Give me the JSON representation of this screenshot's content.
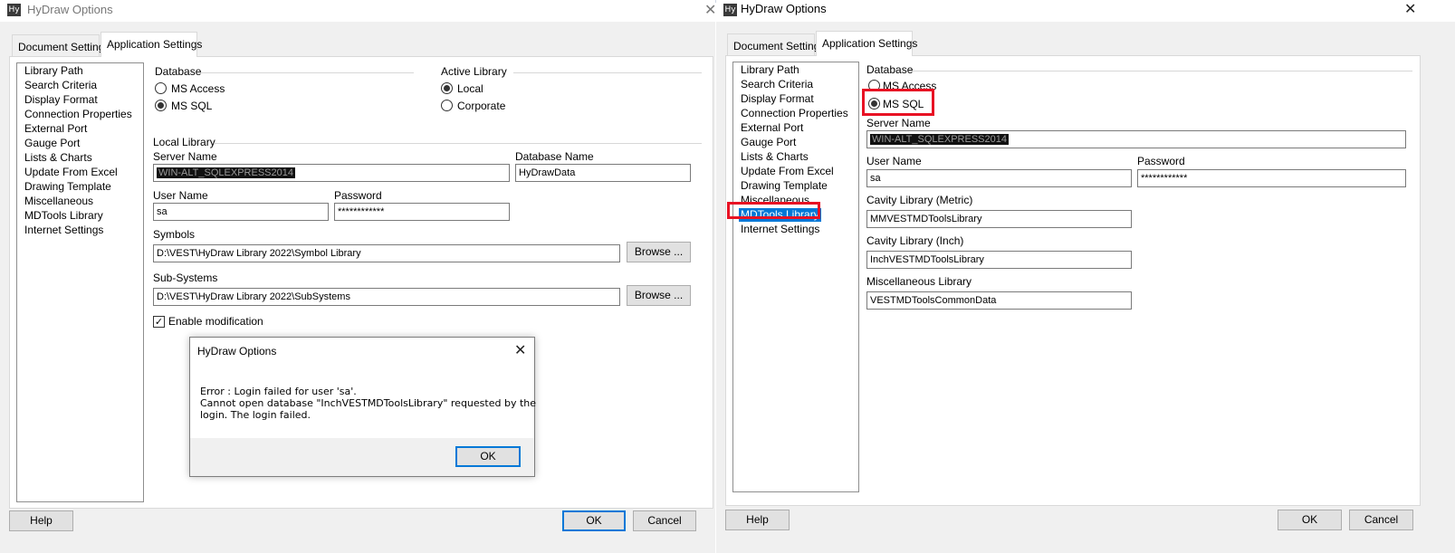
{
  "left_window": {
    "title": "HyDraw Options",
    "tabs": [
      "Document Settings",
      "Application Settings"
    ],
    "nav_items": [
      "Library Path",
      "Search Criteria",
      "Display Format",
      "Connection Properties",
      "External Port",
      "Gauge Port",
      "Lists & Charts",
      "Update From Excel",
      "Drawing Template",
      "Miscellaneous",
      "MDTools Library",
      "Internet Settings"
    ],
    "database_label": "Database",
    "db_options": [
      "MS Access",
      "MS SQL"
    ],
    "db_selected": "MS SQL",
    "active_library_label": "Active Library",
    "active_options": [
      "Local",
      "Corporate"
    ],
    "active_selected": "Local",
    "local_library_label": "Local Library",
    "server_name_label": "Server Name",
    "server_name_value": "WIN-ALT_SQLEXPRESS2014",
    "database_name_label": "Database Name",
    "database_name_value": "HyDrawData",
    "user_name_label": "User Name",
    "user_name_value": "sa",
    "password_label": "Password",
    "password_value": "************",
    "symbols_label": "Symbols",
    "symbols_value": "D:\\VEST\\HyDraw Library 2022\\Symbol Library",
    "subsystems_label": "Sub-Systems",
    "subsystems_value": "D:\\VEST\\HyDraw Library 2022\\SubSystems",
    "browse_label": "Browse ...",
    "enable_modification_label": "Enable modification",
    "enable_modification_checked": true,
    "help_label": "Help",
    "ok_label": "OK",
    "cancel_label": "Cancel"
  },
  "error_dialog": {
    "title": "HyDraw Options",
    "lines": [
      "Error : Login failed for user 'sa'.",
      "Cannot open database \"InchVESTMDToolsLibrary\" requested by the",
      "login. The login failed."
    ],
    "ok_label": "OK"
  },
  "right_window": {
    "title": "HyDraw Options",
    "tabs": [
      "Document Settings",
      "Application Settings"
    ],
    "nav_items": [
      "Library Path",
      "Search Criteria",
      "Display Format",
      "Connection Properties",
      "External Port",
      "Gauge Port",
      "Lists & Charts",
      "Update From Excel",
      "Drawing Template",
      "Miscellaneous",
      "MDTools Library",
      "Internet Settings"
    ],
    "nav_selected": "MDTools Library",
    "database_label": "Database",
    "db_options": [
      "MS Access",
      "MS SQL"
    ],
    "db_selected": "MS SQL",
    "server_name_label": "Server Name",
    "server_name_value": "WIN-ALT_SQLEXPRESS2014",
    "user_name_label": "User Name",
    "user_name_value": "sa",
    "password_label": "Password",
    "password_value": "************",
    "cavity_metric_label": "Cavity Library (Metric)",
    "cavity_metric_value": "MMVESTMDToolsLibrary",
    "cavity_inch_label": "Cavity Library (Inch)",
    "cavity_inch_value": "InchVESTMDToolsLibrary",
    "misc_library_label": "Miscellaneous Library",
    "misc_library_value": "VESTMDToolsCommonData",
    "help_label": "Help",
    "ok_label": "OK",
    "cancel_label": "Cancel"
  },
  "colors": {
    "selection_blue": "#0078d7",
    "highlight_red": "#e81123",
    "dialog_bg": "#f0f0f0"
  },
  "icons": [
    "hydraw-app-icon",
    "close-icon",
    "radio-button",
    "checkbox-check"
  ]
}
